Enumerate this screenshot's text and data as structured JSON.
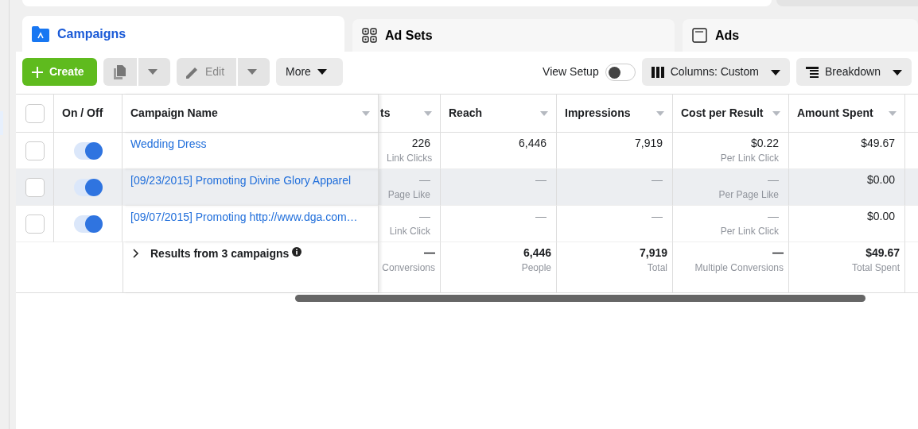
{
  "tabs": [
    {
      "label": "Campaigns",
      "selected": true,
      "kind": "campaigns"
    },
    {
      "label": "Ad Sets",
      "selected": false,
      "kind": "adsets"
    },
    {
      "label": "Ads",
      "selected": false,
      "kind": "ads"
    }
  ],
  "toolbar": {
    "create": "Create",
    "edit": "Edit",
    "edit_disabled": true,
    "more": "More",
    "view_setup": {
      "label": "View Setup",
      "on": false
    },
    "columns": "Columns: Custom",
    "breakdown": "Breakdown"
  },
  "table": {
    "columns": [
      {
        "label": "On / Off",
        "sortable": false
      },
      {
        "label": "Campaign Name",
        "sortable": true
      },
      {
        "label": "ts",
        "sortable": true
      },
      {
        "label": "Reach",
        "sortable": true
      },
      {
        "label": "Impressions",
        "sortable": true
      },
      {
        "label": "Cost per Result",
        "sortable": true
      },
      {
        "label": "Amount Spent",
        "sortable": true
      }
    ],
    "select_all_checked": false,
    "rows": [
      {
        "checked": false,
        "on": true,
        "highlighted": false,
        "name": "Wedding Dress",
        "cells": [
          {
            "value": "226",
            "sub": "Link Clicks"
          },
          {
            "value": "6,446"
          },
          {
            "value": "7,919"
          },
          {
            "value": "$0.22",
            "sub": "Per Link Click"
          },
          {
            "value": "$49.67"
          }
        ]
      },
      {
        "checked": false,
        "on": true,
        "highlighted": true,
        "name": "[09/23/2015] Promoting Divine Glory Apparel",
        "cells": [
          {
            "value": "—",
            "sub": "Page Like"
          },
          {
            "value": "—"
          },
          {
            "value": "—"
          },
          {
            "value": "—",
            "sub": "Per Page Like"
          },
          {
            "value": "$0.00"
          }
        ]
      },
      {
        "checked": false,
        "on": true,
        "highlighted": false,
        "name": "[09/07/2015] Promoting http://www.dga.com…",
        "cells": [
          {
            "value": "—",
            "sub": "Link Click"
          },
          {
            "value": "—"
          },
          {
            "value": "—"
          },
          {
            "value": "—",
            "sub": "Per Link Click"
          },
          {
            "value": "$0.00"
          }
        ]
      }
    ],
    "summary": {
      "label": "Results from 3 campaigns",
      "cells": [
        {
          "value": "—",
          "sub": "Conversions"
        },
        {
          "value": "6,446",
          "sub": "People"
        },
        {
          "value": "7,919",
          "sub": "Total"
        },
        {
          "value": "—",
          "sub": "Multiple Conversions"
        },
        {
          "value": "$49.67",
          "sub": "Total Spent"
        }
      ]
    }
  }
}
